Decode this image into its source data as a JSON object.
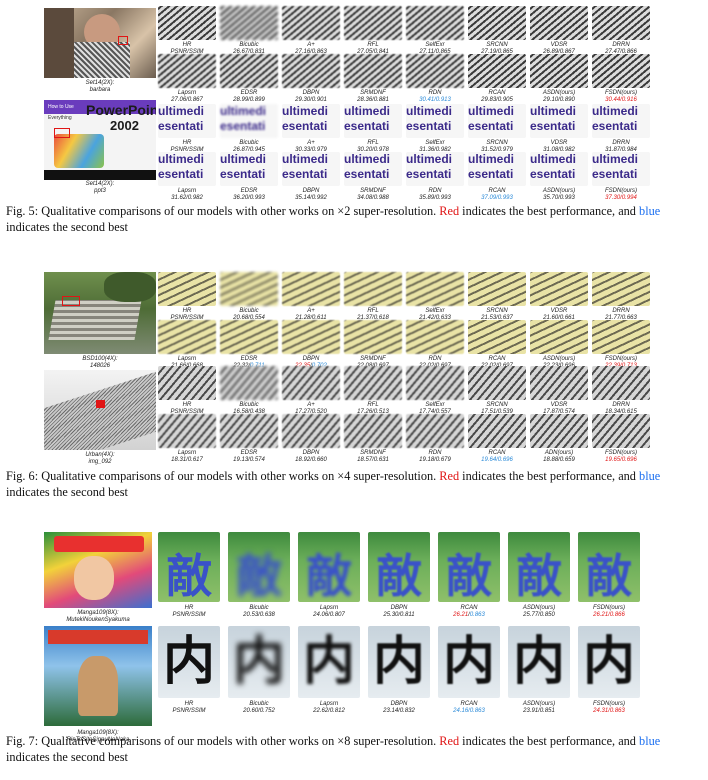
{
  "fig5": {
    "rows": [
      {
        "image_label": [
          "Set14(2X):",
          "barbara"
        ],
        "top": [
          {
            "name": "HR",
            "score": "PSNR/SSIM"
          },
          {
            "name": "Bicubic",
            "score": "26.67/0.831"
          },
          {
            "name": "A+",
            "score": "27.16/0.863"
          },
          {
            "name": "RFL",
            "score": "27.05/0.841"
          },
          {
            "name": "SelfExr",
            "score": "27.11/0.865"
          },
          {
            "name": "SRCNN",
            "score": "27.19/0.865"
          },
          {
            "name": "VDSR",
            "score": "26.89/0.867"
          },
          {
            "name": "DRRN",
            "score": "27.47/0.866"
          }
        ],
        "bottom": [
          {
            "name": "Lapsrn",
            "score": "27.06/0.867"
          },
          {
            "name": "EDSR",
            "score": "28.99/0.899"
          },
          {
            "name": "DBPN",
            "score": "29.30/0.901"
          },
          {
            "name": "SRMDNF",
            "score": "28.36/0.881"
          },
          {
            "name": "RDN",
            "score": "30.41/0.913",
            "hl": "second"
          },
          {
            "name": "RCAN",
            "score": "29.83/0.905"
          },
          {
            "name": "ASDN(ours)",
            "score": "29.10/0.890"
          },
          {
            "name": "FSDN(ours)",
            "score": "30.44/0.916",
            "hl": "best"
          }
        ]
      },
      {
        "image_label": [
          "Set14(2X):",
          "ppt3"
        ],
        "top": [
          {
            "name": "HR",
            "score": "PSNR/SSIM"
          },
          {
            "name": "Bicubic",
            "score": "26.87/0.945"
          },
          {
            "name": "A+",
            "score": "30.33/0.979"
          },
          {
            "name": "RFL",
            "score": "30.20/0.978"
          },
          {
            "name": "SelfExr",
            "score": "31.36/0.982"
          },
          {
            "name": "SRCNN",
            "score": "31.52/0.979"
          },
          {
            "name": "VDSR",
            "score": "31.08/0.982"
          },
          {
            "name": "DRRN",
            "score": "31.87/0.984"
          }
        ],
        "bottom": [
          {
            "name": "Lapsrn",
            "score": "31.62/0.982"
          },
          {
            "name": "EDSR",
            "score": "36.20/0.993"
          },
          {
            "name": "DBPN",
            "score": "35.14/0.992"
          },
          {
            "name": "SRMDNF",
            "score": "34.08/0.988"
          },
          {
            "name": "RDN",
            "score": "35.89/0.993"
          },
          {
            "name": "RCAN",
            "score": "37.09/0.993",
            "hl": "second"
          },
          {
            "name": "ASDN(ours)",
            "score": "35.70/0.993"
          },
          {
            "name": "FSDN(ours)",
            "score": "37.30/0.994",
            "hl": "best"
          }
        ]
      }
    ],
    "ppt_cover": {
      "line1": "How to Use",
      "line2": "Everything",
      "title": "PowerPoint",
      "year": "2002"
    },
    "ppt_text": [
      "ultimedi",
      "esentati"
    ],
    "caption": {
      "prefix": "Fig. 5: Qualitative comparisons of our models with other works on ",
      "scale": "×2",
      "mid": " super-resolution. ",
      "red": "Red",
      "mid2": " indicates the best performance, and ",
      "blue": "blue",
      "suffix": " indicates the second best"
    }
  },
  "fig6": {
    "rows": [
      {
        "image_label": [
          "BSD100(4X):",
          "148026"
        ],
        "top": [
          {
            "name": "HR",
            "score": "PSNR/SSIM"
          },
          {
            "name": "Bicubic",
            "score": "20.68/0.554"
          },
          {
            "name": "A+",
            "score": "21.28/0.611"
          },
          {
            "name": "RFL",
            "score": "21.37/0.618"
          },
          {
            "name": "SelfExr",
            "score": "21.42/0.633"
          },
          {
            "name": "SRCNN",
            "score": "21.53/0.637"
          },
          {
            "name": "VDSR",
            "score": "21.60/0.661"
          },
          {
            "name": "DRRN",
            "score": "21.77/0.663"
          }
        ],
        "bottom": [
          {
            "name": "Lapsrn",
            "score": "21.66/0.668"
          },
          {
            "name": "EDSR",
            "score": "22.32/0.711",
            "hl": "split2"
          },
          {
            "name": "DBPN",
            "score": "22.35/0.702",
            "hl": "split1"
          },
          {
            "name": "SRMDNF",
            "score": "22.08/0.697"
          },
          {
            "name": "RDN",
            "score": "22.02/0.697"
          },
          {
            "name": "RCAN",
            "score": "22.02/0.697"
          },
          {
            "name": "ASDN(ours)",
            "score": "22.23/0.696"
          },
          {
            "name": "FSDN(ours)",
            "score": "22.39/0.713",
            "hl": "best"
          }
        ]
      },
      {
        "image_label": [
          "Urban(4X):",
          "img_092"
        ],
        "top": [
          {
            "name": "HR",
            "score": "PSNR/SSIM"
          },
          {
            "name": "Bicubic",
            "score": "16.58/0.438"
          },
          {
            "name": "A+",
            "score": "17.27/0.520"
          },
          {
            "name": "RFL",
            "score": "17.26/0.513"
          },
          {
            "name": "SelfExr",
            "score": "17.74/0.557"
          },
          {
            "name": "SRCNN",
            "score": "17.51/0.539"
          },
          {
            "name": "VDSR",
            "score": "17.87/0.574"
          },
          {
            "name": "DRRN",
            "score": "18.34/0.615"
          }
        ],
        "bottom": [
          {
            "name": "Lapsrn",
            "score": "18.31/0.617"
          },
          {
            "name": "EDSR",
            "score": "19.13/0.574"
          },
          {
            "name": "DBPN",
            "score": "18.92/0.660"
          },
          {
            "name": "SRMDNF",
            "score": "18.57/0.631"
          },
          {
            "name": "RDN",
            "score": "19.18/0.679"
          },
          {
            "name": "RCAN",
            "score": "19.64/0.696",
            "hl": "second"
          },
          {
            "name": "ADN(ours)",
            "score": "18.88/0.659"
          },
          {
            "name": "FSDN(ours)",
            "score": "19.65/0.696",
            "hl": "best"
          }
        ]
      }
    ],
    "caption": {
      "prefix": "Fig. 6: Qualitative comparisons of our models with other works on ",
      "scale": "×4",
      "mid": " super-resolution. ",
      "red": "Red",
      "mid2": " indicates the best performance, and ",
      "blue": "blue",
      "suffix": " indicates the second best"
    }
  },
  "fig7": {
    "rows": [
      {
        "image_label": [
          "Manga109(8X):",
          "MutekiNoukenSyakuma"
        ],
        "glyph": "敵",
        "cells": [
          {
            "name": "HR",
            "score": "PSNR/SSIM"
          },
          {
            "name": "Bicubic",
            "score": "20.53/0.638"
          },
          {
            "name": "Lapsrn",
            "score": "24.06/0.807"
          },
          {
            "name": "DBPN",
            "score": "25.30/0.811"
          },
          {
            "name": "RCAN",
            "score": "26.21/0.863",
            "hl": "split1"
          },
          {
            "name": "ASDN(ours)",
            "score": "25.77/0.850"
          },
          {
            "name": "FSDN(ours)",
            "score": "26.21/0.866",
            "hl": "best"
          }
        ]
      },
      {
        "image_label": [
          "Manga109(8X):",
          "RinToSiteSippuNoNaka"
        ],
        "glyph": "内",
        "cells": [
          {
            "name": "HR",
            "score": "PSNR/SSIM"
          },
          {
            "name": "Bicubic",
            "score": "20.60/0.752"
          },
          {
            "name": "Lapsrn",
            "score": "22.62/0.812"
          },
          {
            "name": "DBPN",
            "score": "23.14/0.832"
          },
          {
            "name": "RCAN",
            "score": "24.16/0.863",
            "hl": "second"
          },
          {
            "name": "ASDN(ours)",
            "score": "23.91/0.851"
          },
          {
            "name": "FSDN(ours)",
            "score": "24.31/0.863",
            "hl": "best"
          }
        ]
      }
    ],
    "caption": {
      "prefix": "Fig. 7: Qualitative comparisons of our models with other works on ",
      "scale": "×8",
      "mid": " super-resolution. ",
      "red": "Red",
      "mid2": " indicates the best performance, and ",
      "blue": "blue",
      "suffix": " indicates the second best"
    }
  }
}
